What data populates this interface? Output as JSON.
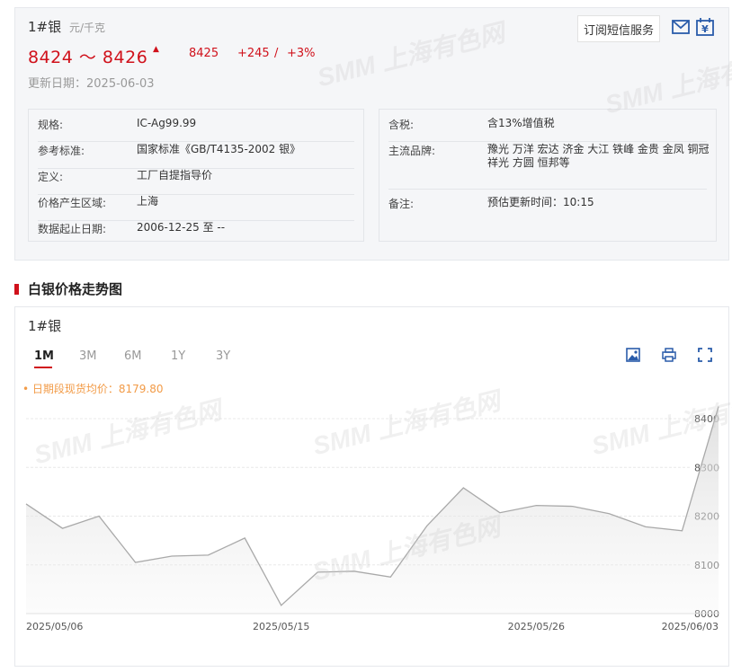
{
  "product": {
    "name": "1#银",
    "unit": "元/千克",
    "price_range": "8424 ～ 8426",
    "avg_price": "8425",
    "change": "+245",
    "change_sep": "/",
    "change_pct": "+3%",
    "update_date": "更新日期：2025-06-03",
    "subscribe_label": "订阅短信服务"
  },
  "details_left": [
    {
      "key": "规格:",
      "value": "IC-Ag99.99"
    },
    {
      "key": "参考标准:",
      "value": "国家标准《GB/T4135-2002 银》"
    },
    {
      "key": "定义:",
      "value": "工厂自提指导价"
    },
    {
      "key": "价格产生区域:",
      "value": "上海"
    },
    {
      "key": "数据起止日期:",
      "value": "2006-12-25 至 --"
    }
  ],
  "details_right": [
    {
      "key": "含税:",
      "value": "含13%增值税"
    },
    {
      "key": "主流品牌:",
      "value": "豫光 万洋 宏达 济金 大江 铁峰 金贵 金凤 铜冠 祥光 方圆 恒邦等"
    },
    {
      "key": "备注:",
      "value": "预估更新时间：10:15"
    }
  ],
  "section_title": "白银价格走势图",
  "chart_panel": {
    "name": "1#银",
    "tabs": [
      "1M",
      "3M",
      "6M",
      "1Y",
      "3Y"
    ],
    "active_tab": "1M",
    "avg_note": "• 日期段现货均价：8179.80"
  },
  "watermark": {
    "brand": "SMM",
    "text": "上海有色网"
  },
  "colors": {
    "accent": "#d0111b",
    "line": "#a9a9a9",
    "avg_note": "#f29b47"
  },
  "chart_data": {
    "type": "area",
    "x": [
      "2025-05-06",
      "2025-05-07",
      "2025-05-08",
      "2025-05-09",
      "2025-05-12",
      "2025-05-13",
      "2025-05-14",
      "2025-05-15",
      "2025-05-16",
      "2025-05-19",
      "2025-05-20",
      "2025-05-21",
      "2025-05-22",
      "2025-05-23",
      "2025-05-26",
      "2025-05-27",
      "2025-05-28",
      "2025-05-29",
      "2025-05-30",
      "2025-06-03"
    ],
    "values": [
      8225,
      8175,
      8200,
      8105,
      8118,
      8120,
      8155,
      8017,
      8085,
      8087,
      8075,
      8180,
      8258,
      8207,
      8222,
      8220,
      8205,
      8178,
      8170,
      8425
    ],
    "x_tick_labels": [
      "2025/05/06",
      "2025/05/15",
      "2025/05/26",
      "2025/06/03"
    ],
    "x_tick_index": [
      0,
      7,
      14,
      19
    ],
    "y_ticks": [
      8000,
      8100,
      8200,
      8300,
      8400
    ],
    "ylim": [
      8000,
      8400
    ],
    "grid": true,
    "y_axis_side": "right"
  }
}
